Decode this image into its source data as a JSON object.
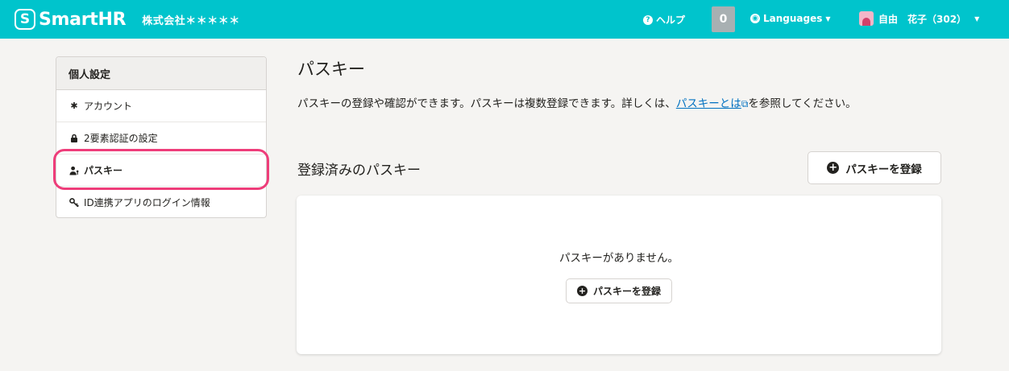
{
  "header": {
    "logo_mark": "S",
    "logo_text": "SmartHR",
    "company": "株式会社＊＊＊＊＊",
    "help_icon": "?",
    "help_label": "ヘルプ",
    "notification_count": "0",
    "languages_label": "Languages",
    "user_name": "自由　花子（302）"
  },
  "sidebar": {
    "heading": "個人設定",
    "items": [
      {
        "icon": "gear-icon",
        "label": "アカウント"
      },
      {
        "icon": "lock-icon",
        "label": "2要素認証の設定"
      },
      {
        "icon": "user-key-icon",
        "label": "パスキー"
      },
      {
        "icon": "key-icon",
        "label": "ID連携アプリのログイン情報"
      }
    ]
  },
  "main": {
    "title": "パスキー",
    "description_before": "パスキーの登録や確認ができます。パスキーは複数登録できます。詳しくは、",
    "description_link": "パスキーとは",
    "description_after": "を参照してください。",
    "section_title": "登録済みのパスキー",
    "register_button": "パスキーを登録",
    "empty_message": "パスキーがありません。",
    "empty_register_button": "パスキーを登録"
  },
  "colors": {
    "header_bg": "#00c4cc",
    "highlight": "#ee3d7a",
    "link": "#0071c1"
  }
}
